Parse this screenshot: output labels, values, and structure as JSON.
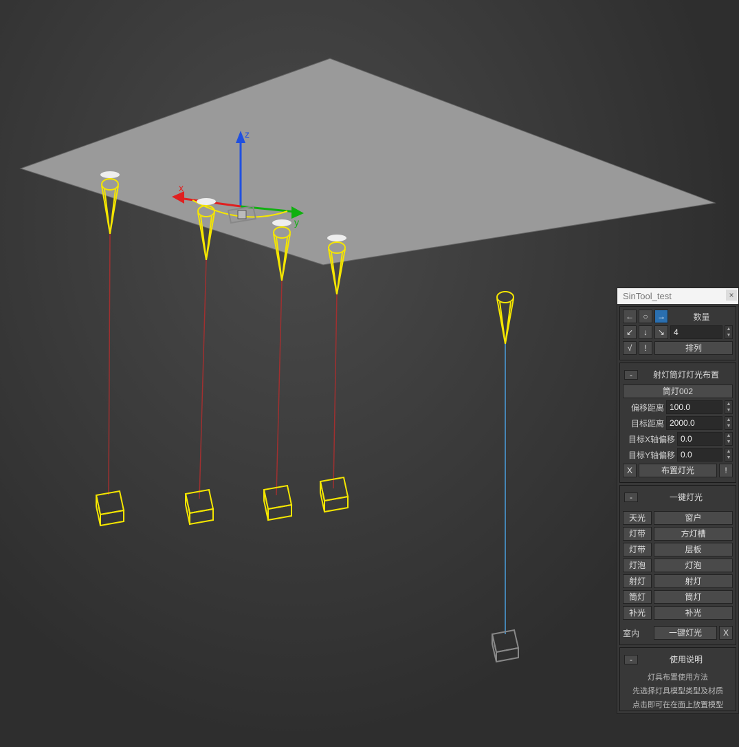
{
  "viewport": {
    "axis": {
      "x_color": "#e02020",
      "y_color": "#10b010",
      "z_color": "#2050e0"
    },
    "light_color": "#f5e600",
    "line_red": "#a03030",
    "line_blue": "#4aa0e0"
  },
  "panel": {
    "title": "SinTool_test",
    "top": {
      "count_label": "数量",
      "count_value": "4",
      "arrange": "排列",
      "icons": [
        "←",
        "○",
        "→",
        "↙",
        "↓",
        "↘",
        "√",
        "!"
      ]
    },
    "lightLayout": {
      "header": "射灯筒灯灯光布置",
      "name_btn": "筒灯002",
      "offset_label": "偏移距离",
      "offset_value": "100.0",
      "target_label": "目标距离",
      "target_value": "2000.0",
      "targetX_label": "目标X轴偏移",
      "targetX_value": "0.0",
      "targetY_label": "目标Y轴偏移",
      "targetY_value": "0.0",
      "x_btn": "X",
      "place_btn": "布置灯光",
      "warn_btn": "!"
    },
    "oneKey": {
      "header": "一键灯光",
      "rows": [
        [
          "天光",
          "窗户"
        ],
        [
          "灯带",
          "方灯槽"
        ],
        [
          "灯带",
          "层板"
        ],
        [
          "灯泡",
          "灯泡"
        ],
        [
          "射灯",
          "射灯"
        ],
        [
          "筒灯",
          "筒灯"
        ],
        [
          "补光",
          "补光"
        ]
      ],
      "bottom_left": "室内",
      "bottom_mid": "一键灯光",
      "bottom_right": "X"
    },
    "help": {
      "header": "使用说明",
      "lines": [
        "灯具布置使用方法",
        "先选择灯具模型类型及材质",
        "点击即可在在面上放置模型"
      ]
    }
  }
}
